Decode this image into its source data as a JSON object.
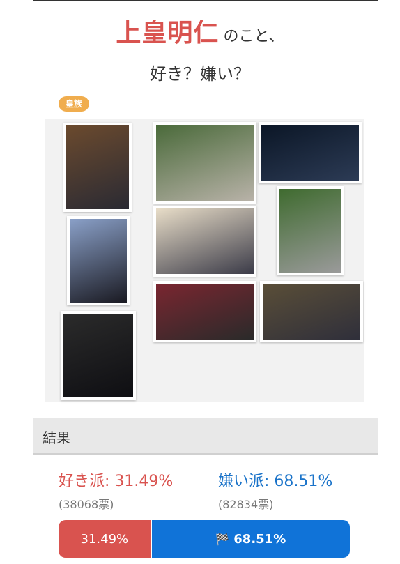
{
  "header": {
    "name": "上皇明仁",
    "suffix": "のこと、",
    "question": "好き？嫌い？"
  },
  "category_badge": "皇族",
  "gallery": {
    "photos": [
      {
        "id": "p1",
        "colors": [
          "#6b4a2e",
          "#2a2a33"
        ]
      },
      {
        "id": "p2",
        "colors": [
          "#4a6a3a",
          "#b8b2a8"
        ]
      },
      {
        "id": "p3",
        "colors": [
          "#0b1626",
          "#2c3b55"
        ]
      },
      {
        "id": "p4",
        "colors": [
          "#8aa0c8",
          "#1a1a22"
        ]
      },
      {
        "id": "p5",
        "colors": [
          "#e8ddc8",
          "#3b3b48"
        ]
      },
      {
        "id": "p6",
        "colors": [
          "#3f6b2f",
          "#9a9a9a"
        ]
      },
      {
        "id": "p7",
        "colors": [
          "#7a2630",
          "#2a2a2a"
        ]
      },
      {
        "id": "p8",
        "colors": [
          "#5a4e38",
          "#2f2f3a"
        ]
      },
      {
        "id": "p9",
        "colors": [
          "#2b2b2b",
          "#0e0e12"
        ]
      }
    ]
  },
  "results": {
    "heading": "結果",
    "like_label": "好き派: 31.49%",
    "dislike_label": "嫌い派: 68.51%",
    "like_votes": "(38068票)",
    "dislike_votes": "(82834票)",
    "like_percent_text": "31.49%",
    "dislike_percent_text": "68.51%",
    "like_fraction": 0.3149,
    "dislike_fraction": 0.6851,
    "like_color": "#d9534f",
    "dislike_color": "#1073d8",
    "flag_icon": "flag-icon"
  }
}
